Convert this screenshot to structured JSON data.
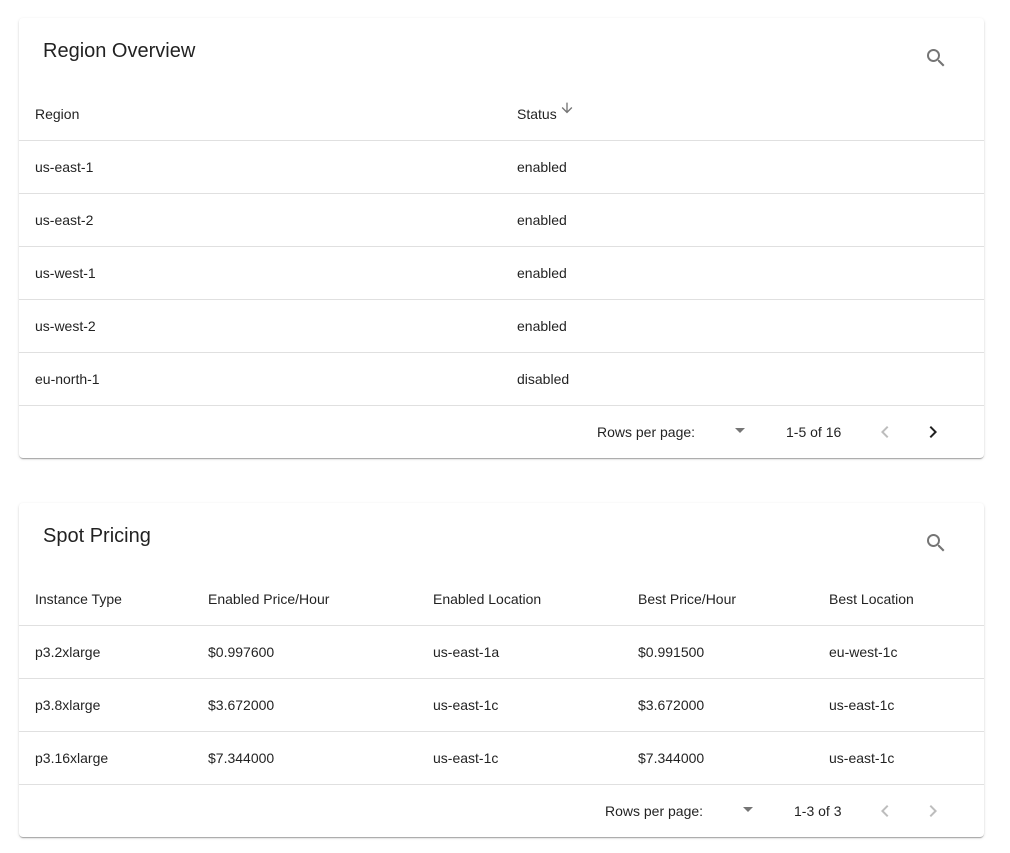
{
  "region_overview": {
    "title": "Region Overview",
    "columns": [
      "Region",
      "Status"
    ],
    "sorted_column": "Status",
    "sort_direction": "descending",
    "rows": [
      {
        "region": "us-east-1",
        "status": "enabled"
      },
      {
        "region": "us-east-2",
        "status": "enabled"
      },
      {
        "region": "us-west-1",
        "status": "enabled"
      },
      {
        "region": "us-west-2",
        "status": "enabled"
      },
      {
        "region": "eu-north-1",
        "status": "disabled"
      }
    ],
    "pagination": {
      "rows_per_page_label": "Rows per page:",
      "rows_per_page_value": "",
      "range": "1-5 of 16",
      "prev_enabled": false,
      "next_enabled": true
    }
  },
  "spot_pricing": {
    "title": "Spot Pricing",
    "columns": [
      "Instance Type",
      "Enabled Price/Hour",
      "Enabled Location",
      "Best Price/Hour",
      "Best Location"
    ],
    "rows": [
      {
        "instance_type": "p3.2xlarge",
        "enabled_price": "$0.997600",
        "enabled_location": "us-east-1a",
        "best_price": "$0.991500",
        "best_location": "eu-west-1c"
      },
      {
        "instance_type": "p3.8xlarge",
        "enabled_price": "$3.672000",
        "enabled_location": "us-east-1c",
        "best_price": "$3.672000",
        "best_location": "us-east-1c"
      },
      {
        "instance_type": "p3.16xlarge",
        "enabled_price": "$7.344000",
        "enabled_location": "us-east-1c",
        "best_price": "$7.344000",
        "best_location": "us-east-1c"
      }
    ],
    "pagination": {
      "rows_per_page_label": "Rows per page:",
      "rows_per_page_value": "",
      "range": "1-3 of 3",
      "prev_enabled": false,
      "next_enabled": false
    }
  },
  "icons": {
    "search": "search-icon",
    "sort": "arrow-down-icon",
    "prev": "chevron-left-icon",
    "next": "chevron-right-icon",
    "dropdown": "arrow-drop-down-icon"
  },
  "colors": {
    "text": "#212121",
    "divider": "#e0e0e0",
    "icon": "#757575",
    "disabled_icon": "#bdbdbd"
  }
}
